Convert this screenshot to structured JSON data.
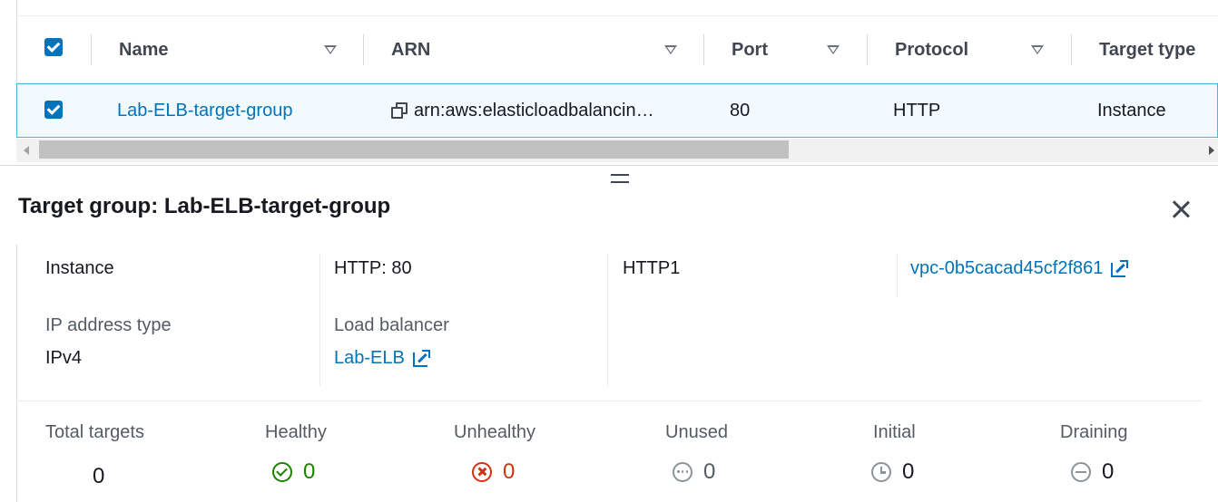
{
  "table": {
    "columns": [
      {
        "label": "Name"
      },
      {
        "label": "ARN"
      },
      {
        "label": "Port"
      },
      {
        "label": "Protocol"
      },
      {
        "label": "Target type"
      }
    ],
    "row": {
      "name": "Lab-ELB-target-group",
      "arn": "arn:aws:elasticloadbalancin…",
      "port": "80",
      "protocol": "HTTP",
      "target_type": "Instance"
    }
  },
  "details": {
    "title": "Target group: Lab-ELB-target-group",
    "target_type_value": "Instance",
    "protocol_port_value": "HTTP: 80",
    "protocol_version_value": "HTTP1",
    "vpc_value": "vpc-0b5cacad45cf2f861",
    "ip_address_type_label": "IP address type",
    "ip_address_type_value": "IPv4",
    "load_balancer_label": "Load balancer",
    "load_balancer_value": "Lab-ELB"
  },
  "counts": {
    "total": {
      "label": "Total targets",
      "value": "0"
    },
    "healthy": {
      "label": "Healthy",
      "value": "0"
    },
    "unhealthy": {
      "label": "Unhealthy",
      "value": "0"
    },
    "unused": {
      "label": "Unused",
      "value": "0"
    },
    "initial": {
      "label": "Initial",
      "value": "0"
    },
    "draining": {
      "label": "Draining",
      "value": "0"
    }
  },
  "colors": {
    "link": "#0073bb",
    "healthy": "#1d8102",
    "unhealthy": "#d13212",
    "neutral": "#8d9499",
    "selected_row_bg": "#f1faff",
    "selected_row_border": "#44b9d6"
  },
  "icons": {
    "copy": "copy-icon",
    "external": "external-link-icon",
    "close": "close-icon",
    "sort": "sort-caret-icon"
  }
}
